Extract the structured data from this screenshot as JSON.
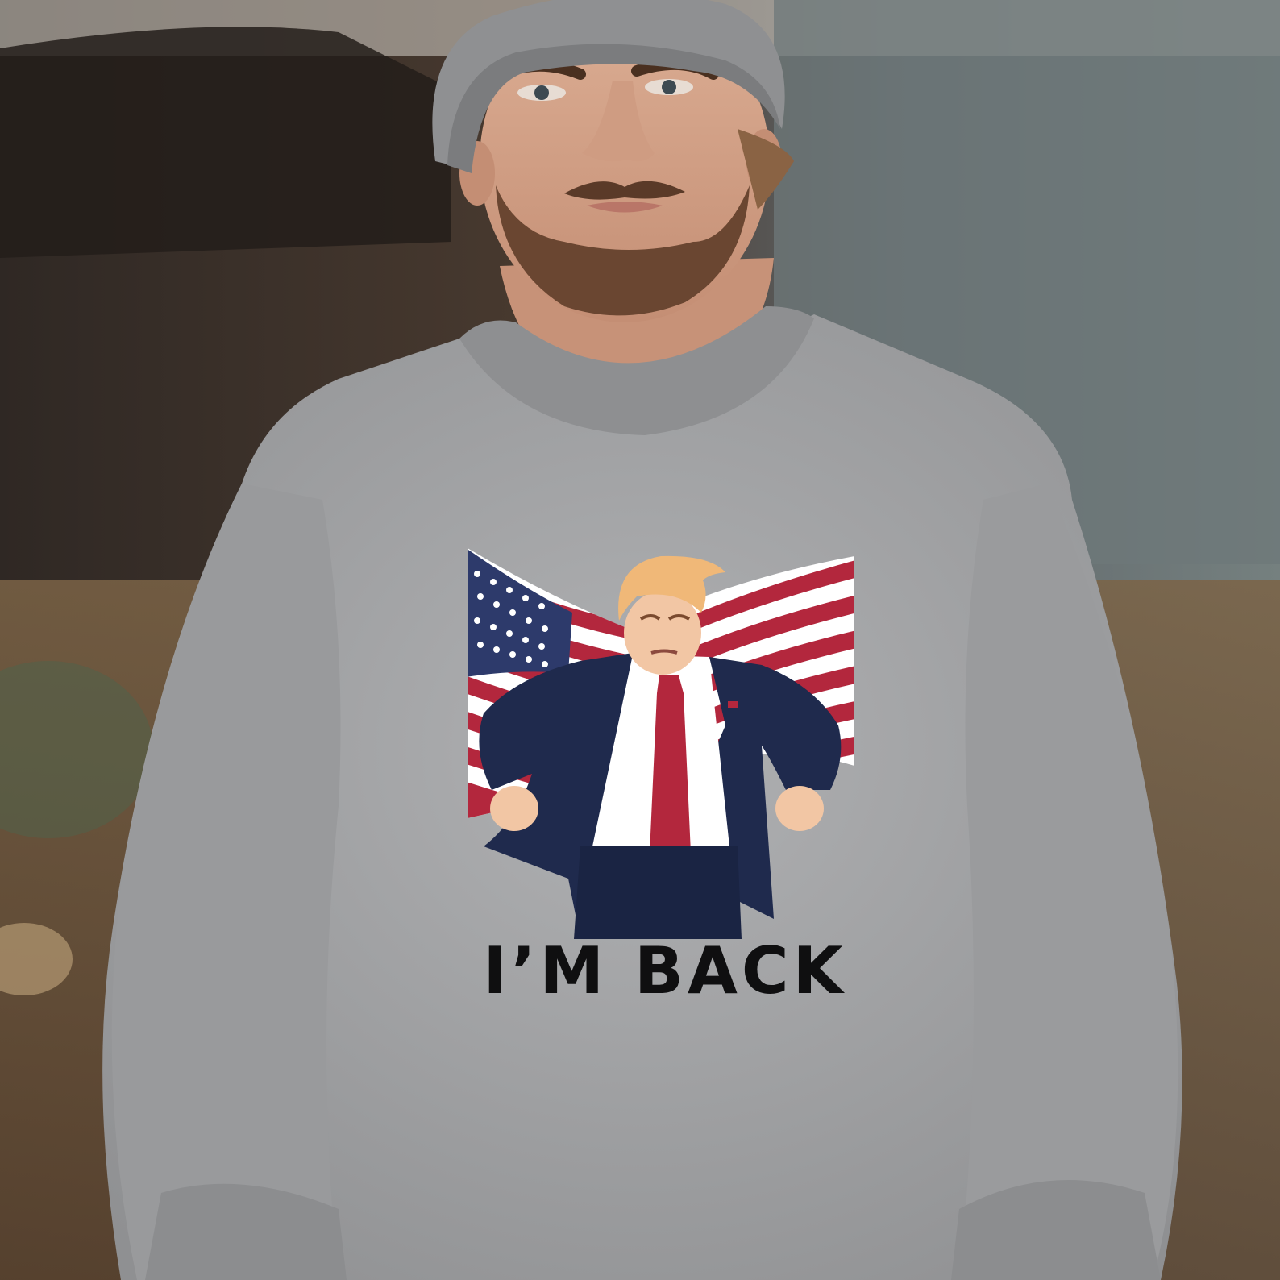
{
  "photo": {
    "subject": "man-wearing-graphic-sweatshirt",
    "colors": {
      "sweatshirt": "#a7a8aa",
      "beanie": "#8f9092",
      "skin": "#d9a98f",
      "beard": "#6a4631",
      "background_dark": "#2c2622",
      "background_field": "#8a6c4c",
      "background_wall": "#6f7a7d"
    }
  },
  "print": {
    "slogan": "I’M BACK",
    "colors": {
      "flag_red": "#b3273d",
      "flag_blue": "#2d3a6b",
      "suit": "#1f2a4d",
      "tie": "#b3273d",
      "shirt": "#ffffff",
      "hair": "#f0b878",
      "text": "#0f0f10"
    }
  }
}
